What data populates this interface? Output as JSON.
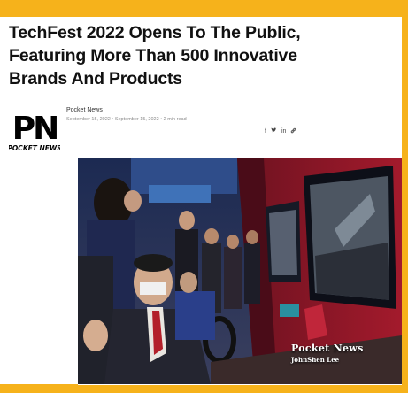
{
  "article": {
    "headline_line1": "TechFest 2022 Opens To The Public,",
    "headline_line2": "Featuring More Than 500 Innovative",
    "headline_line3": "Brands And Products",
    "source": "Pocket News",
    "dates": "September 15, 2022 • September 15, 2022 • 2 min read"
  },
  "logo": {
    "initials": "PN",
    "wordmark": "POCKET NEWS"
  },
  "share": {
    "facebook": "f",
    "twitter": "t",
    "linkedin": "in",
    "link": "link-icon"
  },
  "photo": {
    "watermark_brand": "Pocket News",
    "watermark_credit": "JohnShen Lee"
  },
  "colors": {
    "frame": "#f6b21b",
    "headline": "#111111"
  }
}
